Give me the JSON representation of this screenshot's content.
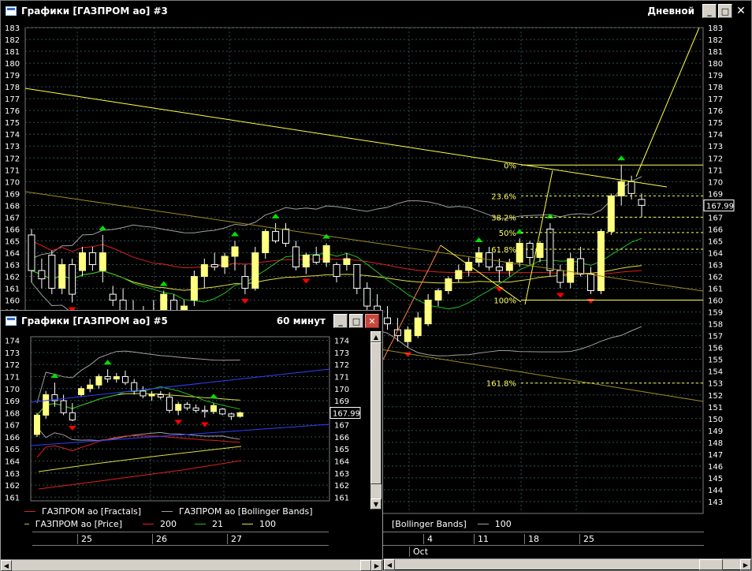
{
  "main_window": {
    "title": "Графики [ГАЗПРОМ ао] #3",
    "timeframe": "Дневной",
    "current_price": "167.99",
    "fib_levels": [
      {
        "label": "0%",
        "value": 171.4
      },
      {
        "label": "23.6%",
        "value": 168.8
      },
      {
        "label": "38.2%",
        "value": 167.0
      },
      {
        "label": "50%",
        "value": 165.7
      },
      {
        "label": "61.8%",
        "value": 164.3
      },
      {
        "label": "100%",
        "value": 160.0
      },
      {
        "label": "161.8%",
        "value": 153.0
      }
    ],
    "date_labels": [
      "4",
      "11",
      "18",
      "25"
    ],
    "month_label": "Oct",
    "legend_partial": {
      "bb": "[Bollinger Bands]",
      "ma100": "100"
    },
    "colors": {
      "bull": "#ffff80",
      "bear": "#000000",
      "ma200": "#e02020",
      "ma21": "#20c020",
      "ma100": "#e0e040",
      "bb": "#a0a0a0",
      "fractal_up": "#00e000",
      "fractal_down": "#ff0000",
      "trend": "#ffff40",
      "fib": "#ffff60"
    }
  },
  "sub_window": {
    "title": "Графики [ГАЗПРОМ ао] #5",
    "timeframe": "60 минут",
    "current_price": "167.99",
    "date_labels": [
      "25",
      "26",
      "27"
    ],
    "legend": {
      "fractals": "ГАЗПРОМ ао [Fractals]",
      "bollinger": "ГАЗПРОМ ао [Bollinger Bands]",
      "price": "ГАЗПРОМ ао [Price]",
      "ma200": "200",
      "ma21": "21",
      "ma100": "100"
    }
  },
  "chart_data": [
    {
      "type": "candlestick",
      "title": "Графики [ГАЗПРОМ ао] #3",
      "ylim": [
        142,
        183
      ],
      "y_ticks": [
        143,
        144,
        145,
        146,
        147,
        148,
        149,
        150,
        151,
        152,
        153,
        154,
        155,
        156,
        157,
        158,
        159,
        160,
        161,
        162,
        163,
        164,
        165,
        166,
        167,
        168,
        169,
        170,
        171,
        172,
        173,
        174,
        175,
        176,
        177,
        178,
        179,
        180,
        181,
        182,
        183
      ],
      "candles": [
        [
          165.5,
          166,
          161.5,
          162.5
        ],
        [
          162.5,
          163.5,
          161,
          161.8
        ],
        [
          163.8,
          164.2,
          160.5,
          161
        ],
        [
          161,
          163.5,
          160.5,
          163
        ],
        [
          163,
          163.5,
          159.8,
          160.5
        ],
        [
          162.5,
          164.5,
          162,
          164
        ],
        [
          164,
          164.5,
          162.5,
          163
        ],
        [
          162.5,
          165.5,
          161.5,
          164
        ],
        [
          160.5,
          161.2,
          159.5,
          160
        ],
        [
          160,
          161,
          158.5,
          159
        ],
        [
          159,
          160,
          157.5,
          158
        ],
        [
          158,
          159.5,
          157,
          159
        ],
        [
          159,
          160,
          158,
          158.5
        ],
        [
          158.5,
          160.8,
          158,
          160.5
        ],
        [
          160,
          160.5,
          158.5,
          159
        ],
        [
          159,
          160,
          158,
          159.5
        ],
        [
          160,
          162.5,
          159.5,
          162
        ],
        [
          162,
          163.5,
          161,
          163
        ],
        [
          163,
          164,
          162.5,
          162.8
        ],
        [
          162.8,
          164,
          162.2,
          163.7
        ],
        [
          163.7,
          165,
          162.5,
          164.5
        ],
        [
          162,
          163,
          160.5,
          161
        ],
        [
          161,
          164.5,
          160.8,
          164
        ],
        [
          164,
          166,
          163.5,
          165.8
        ],
        [
          165.8,
          166.5,
          164.8,
          165
        ],
        [
          166,
          166.5,
          164.5,
          164.8
        ],
        [
          164.5,
          165,
          162.5,
          162.8
        ],
        [
          162.8,
          164,
          162.2,
          163.8
        ],
        [
          163.8,
          164.5,
          163,
          163.2
        ],
        [
          163.2,
          164.8,
          162.8,
          164.6
        ],
        [
          163,
          163.2,
          161.5,
          162
        ],
        [
          163,
          164,
          162.5,
          163.5
        ],
        [
          163,
          163,
          160.5,
          161
        ],
        [
          161,
          161.5,
          159,
          159.5
        ],
        [
          159.5,
          160.5,
          158,
          158.5
        ],
        [
          158.5,
          159.5,
          157.5,
          158
        ],
        [
          157.5,
          158.5,
          156.5,
          157
        ],
        [
          156.5,
          157.8,
          156,
          157.5
        ],
        [
          157,
          159,
          156.8,
          158.5
        ],
        [
          158,
          160.5,
          157.8,
          160
        ],
        [
          160,
          161,
          159.5,
          160.8
        ],
        [
          160.8,
          162,
          160.5,
          161.8
        ],
        [
          161.8,
          163,
          161.5,
          162.5
        ],
        [
          162.5,
          163.6,
          162,
          163.2
        ],
        [
          163.2,
          164.5,
          162.8,
          164
        ],
        [
          164,
          164.5,
          162.5,
          162.8
        ],
        [
          162.8,
          163.5,
          161.5,
          162.5
        ],
        [
          162.5,
          163.5,
          162,
          163.2
        ],
        [
          163.2,
          165.2,
          162.8,
          164.8
        ],
        [
          164.8,
          165,
          163,
          163.6
        ],
        [
          163.6,
          165,
          163.2,
          164.8
        ],
        [
          166,
          166.5,
          162,
          162.5
        ],
        [
          162.5,
          163,
          161,
          161.5
        ],
        [
          161.5,
          164,
          161,
          163.5
        ],
        [
          163.5,
          164.5,
          162,
          162.2
        ],
        [
          162.2,
          162.8,
          160.5,
          160.8
        ],
        [
          160.8,
          166,
          160.5,
          165.8
        ],
        [
          165.8,
          169,
          165.5,
          168.8
        ],
        [
          168.8,
          171.4,
          168,
          170
        ],
        [
          170,
          170.5,
          168.5,
          169
        ],
        [
          168.5,
          169,
          167,
          168
        ]
      ]
    },
    {
      "type": "candlestick",
      "title": "Графики [ГАЗПРОМ ао] #5",
      "ylim": [
        160.7,
        174.3
      ],
      "y_ticks": [
        161,
        162,
        163,
        164,
        165,
        166,
        167,
        168,
        169,
        170,
        171,
        172,
        173,
        174
      ],
      "candles": [
        [
          166.2,
          168,
          166,
          167.8
        ],
        [
          167.8,
          169.8,
          167.5,
          169.5
        ],
        [
          169.5,
          170.5,
          168.5,
          169
        ],
        [
          169,
          169.5,
          167.8,
          168
        ],
        [
          168,
          168.8,
          167.3,
          167.4
        ],
        [
          169.5,
          170.2,
          169.3,
          170
        ],
        [
          170,
          170.8,
          169.7,
          170.3
        ],
        [
          170.3,
          171.2,
          170,
          171
        ],
        [
          171,
          171.6,
          170.5,
          170.8
        ],
        [
          170.8,
          171.3,
          170.5,
          171
        ],
        [
          171,
          171.5,
          170.3,
          170.5
        ],
        [
          170.5,
          170.8,
          169.5,
          169.8
        ],
        [
          169.8,
          170.2,
          169.2,
          169.4
        ],
        [
          169.4,
          169.8,
          169,
          169.5
        ],
        [
          169.5,
          169.8,
          169.1,
          169.3
        ],
        [
          169.3,
          169.7,
          168,
          168.2
        ],
        [
          168.2,
          168.9,
          167.8,
          168.7
        ],
        [
          168.7,
          168.9,
          168.2,
          168.4
        ],
        [
          168.4,
          168.7,
          168,
          168.2
        ],
        [
          168.2,
          168.6,
          167.6,
          168.1
        ],
        [
          168.1,
          168.8,
          167.9,
          168.6
        ],
        [
          168.3,
          168.4,
          167.8,
          167.9
        ],
        [
          167.9,
          168,
          167.4,
          167.7
        ],
        [
          167.7,
          168.1,
          167.6,
          168
        ]
      ]
    }
  ]
}
